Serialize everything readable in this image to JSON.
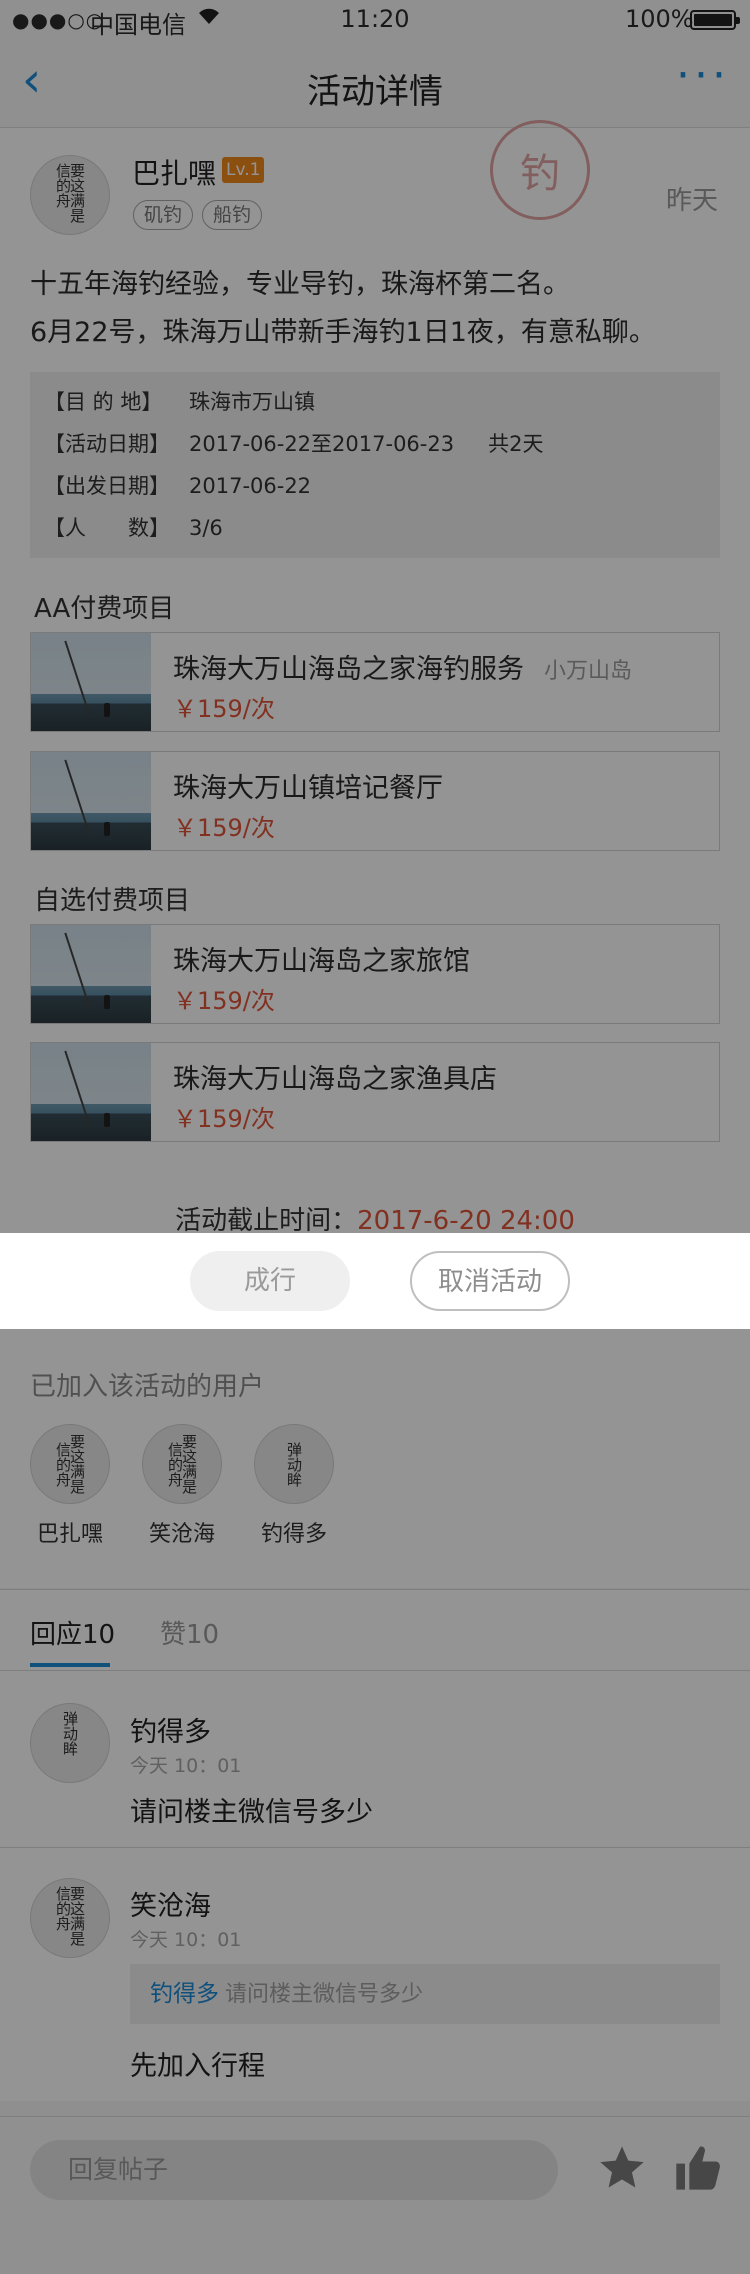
{
  "status_bar": {
    "carrier": "中国电信",
    "time": "11:20",
    "battery": "100%"
  },
  "nav": {
    "title": "活动详情"
  },
  "post": {
    "author": "巴扎嘿",
    "level": "Lv.1",
    "tags": [
      "矶钓",
      "船钓"
    ],
    "time": "昨天",
    "stamp": "钓",
    "description": [
      "十五年海钓经验，专业导钓，珠海杯第二名。",
      "6月22号，珠海万山带新手海钓1日1夜，有意私聊。"
    ],
    "info": {
      "destination_label": "【目 的 地】",
      "destination": "珠海市万山镇",
      "dates_label": "【活动日期】",
      "dates": "2017-06-22至2017-06-23",
      "duration": "共2天",
      "departure_label": "【出发日期】",
      "departure": "2017-06-22",
      "people_label": "【人　　数】",
      "people": "3/6"
    },
    "aa_title": "AA付费项目",
    "aa_items": [
      {
        "name": "珠海大万山海岛之家海钓服务",
        "sub": "小万山岛",
        "price": "￥159/次"
      },
      {
        "name": "珠海大万山镇培记餐厅",
        "price": "￥159/次"
      }
    ],
    "optional_title": "自选付费项目",
    "optional_items": [
      {
        "name": "珠海大万山海岛之家旅馆",
        "price": "￥159/次"
      },
      {
        "name": "珠海大万山海岛之家渔具店",
        "price": "￥159/次"
      }
    ],
    "deadline_label": "活动截止时间：",
    "deadline": "2017-6-20 24:00"
  },
  "actions": {
    "confirm": "成行",
    "cancel": "取消活动"
  },
  "joined": {
    "title": "已加入该活动的用户",
    "users": [
      {
        "name": "巴扎嘿",
        "avatar_text": "要这满是信的舟"
      },
      {
        "name": "笑沧海",
        "avatar_text": "要这满是信的舟"
      },
      {
        "name": "钓得多",
        "avatar_text": "弹动眸"
      }
    ]
  },
  "tabs": {
    "replies": "回应10",
    "likes": "赞10"
  },
  "comments": [
    {
      "user": "钓得多",
      "time": "今天 10：01",
      "text": "请问楼主微信号多少",
      "avatar_text": "弹动眸"
    },
    {
      "user": "笑沧海",
      "time": "今天 10：01",
      "quote_user": "钓得多",
      "quote_text": "请问楼主微信号多少",
      "text": "先加入行程",
      "avatar_text": "要这满是信的舟"
    }
  ],
  "bottom": {
    "reply_placeholder": "回复帖子"
  },
  "colors": {
    "accent": "#1c8bd6",
    "price": "#e0553a",
    "level": "#f08a1c"
  }
}
